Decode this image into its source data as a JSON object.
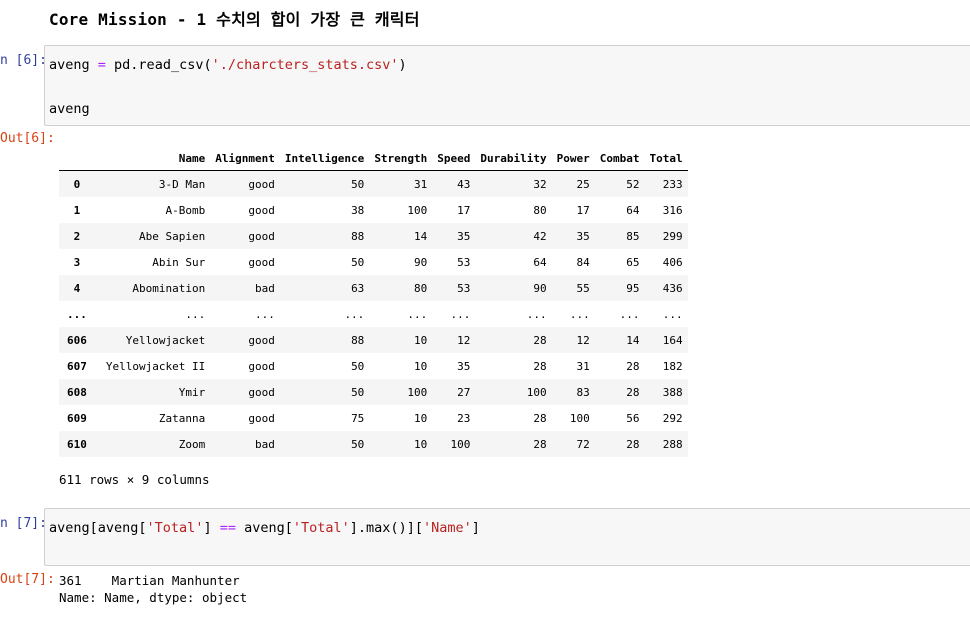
{
  "heading": "Core Mission - 1 수치의 합이 가장 큰 캐릭터",
  "cell6": {
    "in_prompt": "n [6]:",
    "out_prompt": "Out[6]:",
    "code_line1": [
      "aveng ",
      "=",
      " pd.read_csv(",
      "'./charcters_stats.csv'",
      ")"
    ],
    "code_line3": "aveng"
  },
  "table": {
    "columns": [
      "",
      "Name",
      "Alignment",
      "Intelligence",
      "Strength",
      "Speed",
      "Durability",
      "Power",
      "Combat",
      "Total"
    ],
    "rows": [
      [
        "0",
        "3-D Man",
        "good",
        "50",
        "31",
        "43",
        "32",
        "25",
        "52",
        "233"
      ],
      [
        "1",
        "A-Bomb",
        "good",
        "38",
        "100",
        "17",
        "80",
        "17",
        "64",
        "316"
      ],
      [
        "2",
        "Abe Sapien",
        "good",
        "88",
        "14",
        "35",
        "42",
        "35",
        "85",
        "299"
      ],
      [
        "3",
        "Abin Sur",
        "good",
        "50",
        "90",
        "53",
        "64",
        "84",
        "65",
        "406"
      ],
      [
        "4",
        "Abomination",
        "bad",
        "63",
        "80",
        "53",
        "90",
        "55",
        "95",
        "436"
      ],
      [
        "...",
        "...",
        "...",
        "...",
        "...",
        "...",
        "...",
        "...",
        "...",
        "..."
      ],
      [
        "606",
        "Yellowjacket",
        "good",
        "88",
        "10",
        "12",
        "28",
        "12",
        "14",
        "164"
      ],
      [
        "607",
        "Yellowjacket II",
        "good",
        "50",
        "10",
        "35",
        "28",
        "31",
        "28",
        "182"
      ],
      [
        "608",
        "Ymir",
        "good",
        "50",
        "100",
        "27",
        "100",
        "83",
        "28",
        "388"
      ],
      [
        "609",
        "Zatanna",
        "good",
        "75",
        "10",
        "23",
        "28",
        "100",
        "56",
        "292"
      ],
      [
        "610",
        "Zoom",
        "bad",
        "50",
        "10",
        "100",
        "28",
        "72",
        "28",
        "288"
      ]
    ],
    "shape": "611 rows × 9 columns"
  },
  "cell7": {
    "in_prompt": "n [7]:",
    "out_prompt": "Out[7]:",
    "code": [
      "aveng[aveng[",
      "'Total'",
      "] ",
      "==",
      " aveng[",
      "'Total'",
      "].max()][",
      "'Name'",
      "]"
    ],
    "output_line1": "361    Martian Manhunter",
    "output_line2": "Name: Name, dtype: object"
  },
  "colors": {
    "in_prompt": "#303f9f",
    "out_prompt": "#d84315",
    "string": "#ba2121",
    "operator": "#aa22ff"
  }
}
